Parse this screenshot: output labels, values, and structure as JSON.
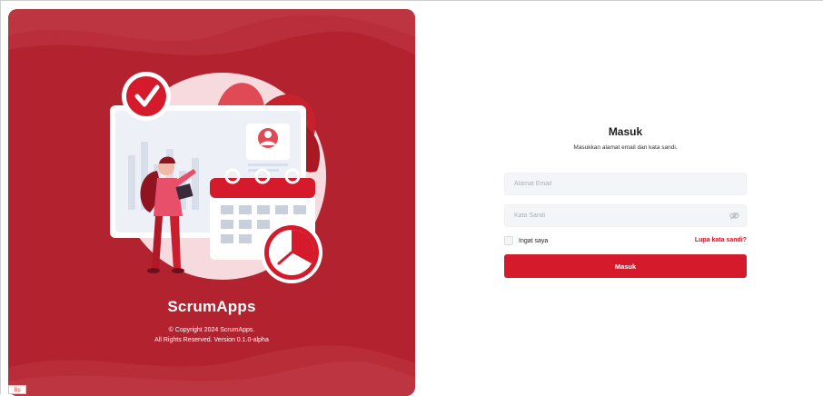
{
  "brand": {
    "name": "ScrumApps",
    "copyright_line1": "© Copyright 2024 ScrumApps.",
    "copyright_line2": "All Rights Reserved. Version 0.1.0-alpha"
  },
  "login": {
    "title": "Masuk",
    "subtitle": "Masukkan alamat email dan kata sandi.",
    "email_placeholder": "Alamat Email",
    "password_placeholder": "Kata Sandi",
    "remember_label": "Ingat saya",
    "forgot_label": "Lupa kata sandi?",
    "submit_label": "Masuk"
  },
  "icons": {
    "password_toggle": "eye-slash-icon",
    "hero": "check-calendar-clock-illustration"
  },
  "colors": {
    "panel": "#b2232f",
    "accent": "#d51a2c",
    "link": "#d1142a"
  },
  "corner_badge": "Bp"
}
